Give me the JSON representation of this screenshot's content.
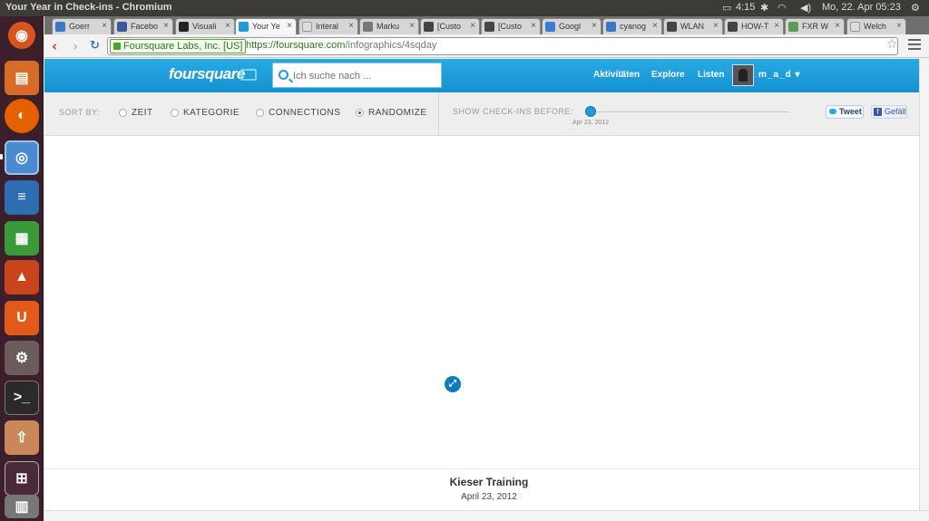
{
  "panel": {
    "window_title": "Your Year in Check-ins - Chromium",
    "time": "4:15",
    "datetime": "Mo, 22. Apr  05:23"
  },
  "launcher": {
    "items": [
      {
        "name": "ubuntu-dash-icon",
        "color": "#d9531e"
      },
      {
        "name": "files-icon",
        "color": "#d86b27"
      },
      {
        "name": "firefox-icon",
        "color": "#e66000"
      },
      {
        "name": "chromium-icon",
        "color": "#4a8ad0"
      },
      {
        "name": "writer-icon",
        "color": "#2f6db3"
      },
      {
        "name": "calc-icon",
        "color": "#3a9a3a"
      },
      {
        "name": "software-center-icon",
        "color": "#c8451c"
      },
      {
        "name": "ubuntu-one-icon",
        "color": "#e05b1a"
      },
      {
        "name": "settings-icon",
        "color": "#6b5b5b"
      },
      {
        "name": "terminal-icon",
        "color": "#2a2a2a"
      },
      {
        "name": "update-icon",
        "color": "#c9875a"
      },
      {
        "name": "workspaces-icon",
        "color": "#4a2a3a"
      },
      {
        "name": "trash-icon",
        "color": "#777777"
      }
    ]
  },
  "tabs": [
    {
      "label": "Goerr",
      "fav": "#3b76c4"
    },
    {
      "label": "Facebo",
      "fav": "#3b5998"
    },
    {
      "label": "Visuali",
      "fav": "#222222"
    },
    {
      "label": "Your Ye",
      "fav": "#1c9cdb",
      "active": true
    },
    {
      "label": "Interal",
      "fav": "#dddddd"
    },
    {
      "label": "Marku",
      "fav": "#777777"
    },
    {
      "label": "[Custo",
      "fav": "#444444"
    },
    {
      "label": "[Custo",
      "fav": "#444444"
    },
    {
      "label": "Googl",
      "fav": "#3a7bd5"
    },
    {
      "label": "cyanog",
      "fav": "#3b76c4"
    },
    {
      "label": "WLAN",
      "fav": "#444444"
    },
    {
      "label": "HOW-T",
      "fav": "#444444"
    },
    {
      "label": "FXR W",
      "fav": "#5a9a5a"
    },
    {
      "label": "Welch",
      "fav": "#dddddd"
    }
  ],
  "omnibox": {
    "ev_label": "Foursquare Labs, Inc. [US]",
    "url_host": "https://foursquare.com",
    "url_path": "/infographics/4sqday"
  },
  "header": {
    "logo": "foursquare",
    "search_placeholder": "Ich suche nach ...",
    "nav": [
      "Aktivitäten",
      "Explore",
      "Listen"
    ],
    "user": "m_a_d ▾"
  },
  "filters": {
    "sort_by_label": "SORT BY:",
    "options": [
      "ZEIT",
      "KATEGORIE",
      "CONNECTIONS",
      "RANDOMIZE"
    ],
    "selected": "RANDOMIZE",
    "show_label": "SHOW CHECK-INS BEFORE:",
    "slider_date": "Apr 23, 2012",
    "tweet": "Tweet",
    "like": "Gefällt"
  },
  "venue": {
    "name": "Kieser Training",
    "date": "April 23, 2012"
  },
  "colors": {
    "brand": "#1c9cdb",
    "launcher_bg": "#3b1f2b",
    "panel_bg": "#3c3b37"
  }
}
